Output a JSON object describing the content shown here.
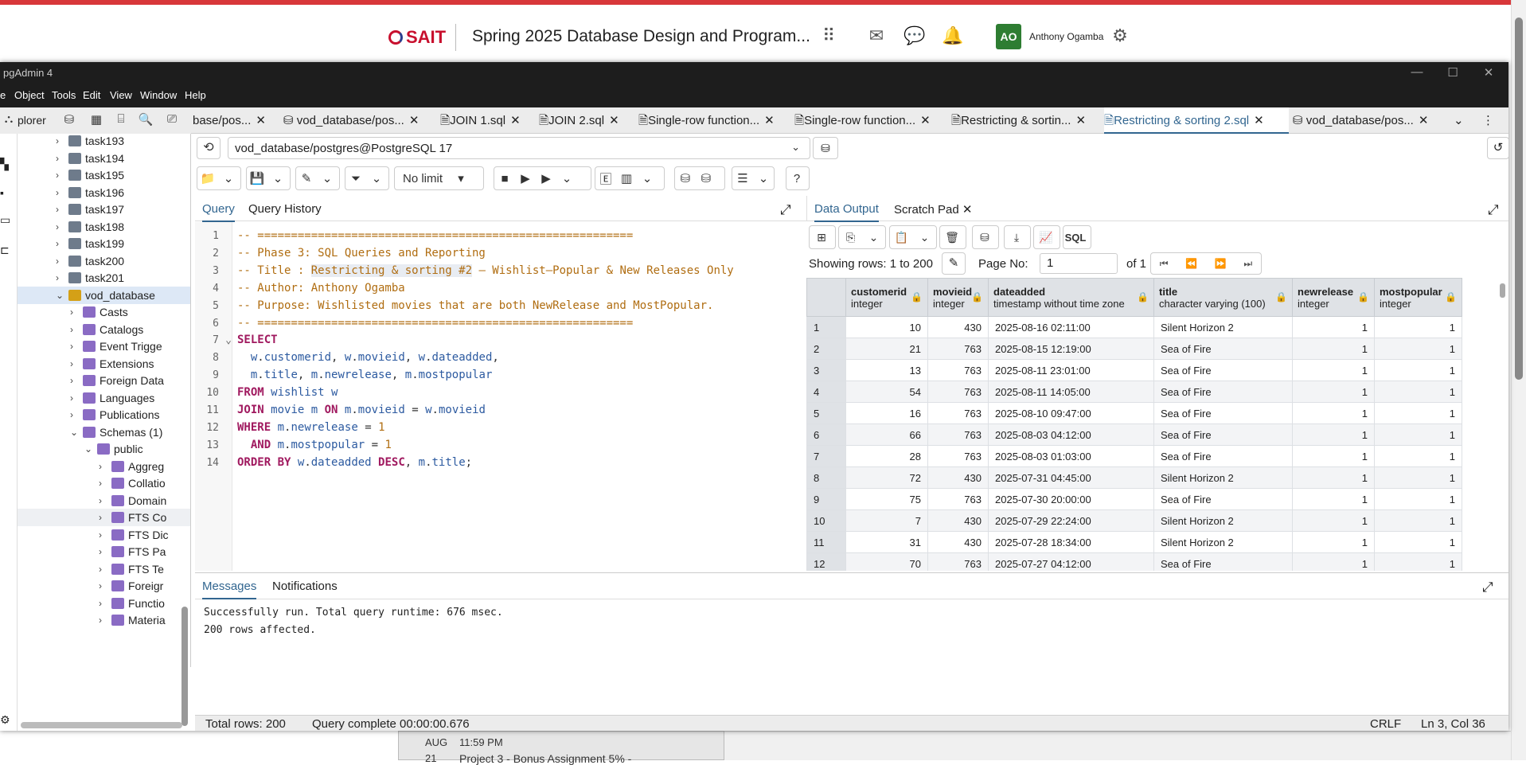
{
  "lms": {
    "logo": "SAIT",
    "course": "Spring 2025 Database Design and Program...",
    "avatar": "AO",
    "user": "Anthony Ogamba"
  },
  "behind": {
    "month": "AUG",
    "day": "21",
    "time": "11:59 PM",
    "item": "Project 3 - Bonus Assignment 5% -"
  },
  "window": {
    "title": "pgAdmin 4",
    "menu": [
      "e",
      "Object",
      "Tools",
      "Edit",
      "View",
      "Window",
      "Help"
    ]
  },
  "explorer": {
    "label": "plorer"
  },
  "tabs": [
    {
      "label": "base/pos...",
      "active": false
    },
    {
      "label": "vod_database/pos...",
      "active": false
    },
    {
      "label": "JOIN 1.sql",
      "active": false
    },
    {
      "label": "JOIN 2.sql",
      "active": false
    },
    {
      "label": "Single-row function...",
      "active": false
    },
    {
      "label": "Single-row function...",
      "active": false
    },
    {
      "label": "Restricting & sortin...",
      "active": false
    },
    {
      "label": "Restricting & sorting 2.sql",
      "active": true
    },
    {
      "label": "vod_database/pos...",
      "active": false
    }
  ],
  "tree": [
    {
      "label": "task193",
      "indent": 0,
      "icon": "table-icon"
    },
    {
      "label": "task194",
      "indent": 0,
      "icon": "table-icon"
    },
    {
      "label": "task195",
      "indent": 0,
      "icon": "table-icon"
    },
    {
      "label": "task196",
      "indent": 0,
      "icon": "table-icon"
    },
    {
      "label": "task197",
      "indent": 0,
      "icon": "table-icon"
    },
    {
      "label": "task198",
      "indent": 0,
      "icon": "table-icon"
    },
    {
      "label": "task199",
      "indent": 0,
      "icon": "table-icon"
    },
    {
      "label": "task200",
      "indent": 0,
      "icon": "table-icon"
    },
    {
      "label": "task201",
      "indent": 0,
      "icon": "table-icon"
    },
    {
      "label": "vod_database",
      "indent": 0,
      "icon": "database-icon",
      "open": true,
      "selected": true
    },
    {
      "label": "Casts",
      "indent": 1,
      "icon": "casts-icon"
    },
    {
      "label": "Catalogs",
      "indent": 1,
      "icon": "catalogs-icon"
    },
    {
      "label": "Event Trigge",
      "indent": 1,
      "icon": "event-trigger-icon"
    },
    {
      "label": "Extensions",
      "indent": 1,
      "icon": "extensions-icon"
    },
    {
      "label": "Foreign Data",
      "indent": 1,
      "icon": "foreign-data-icon"
    },
    {
      "label": "Languages",
      "indent": 1,
      "icon": "languages-icon"
    },
    {
      "label": "Publications",
      "indent": 1,
      "icon": "publications-icon"
    },
    {
      "label": "Schemas (1)",
      "indent": 1,
      "icon": "schemas-icon",
      "open": true
    },
    {
      "label": "public",
      "indent": 2,
      "icon": "schema-icon",
      "open": true
    },
    {
      "label": "Aggreg",
      "indent": 3,
      "icon": "aggregate-icon"
    },
    {
      "label": "Collatio",
      "indent": 3,
      "icon": "collation-icon"
    },
    {
      "label": "Domain",
      "indent": 3,
      "icon": "domain-icon"
    },
    {
      "label": "FTS Co",
      "indent": 3,
      "icon": "fts-config-icon",
      "hover": true
    },
    {
      "label": "FTS Dic",
      "indent": 3,
      "icon": "fts-dict-icon"
    },
    {
      "label": "FTS Pa",
      "indent": 3,
      "icon": "fts-parser-icon"
    },
    {
      "label": "FTS Te",
      "indent": 3,
      "icon": "fts-template-icon"
    },
    {
      "label": "Foreigr",
      "indent": 3,
      "icon": "foreign-table-icon"
    },
    {
      "label": "Functio",
      "indent": 3,
      "icon": "function-icon"
    },
    {
      "label": "Materia",
      "indent": 3,
      "icon": "mview-icon"
    }
  ],
  "connection": "vod_database/postgres@PostgreSQL 17",
  "toolbar": {
    "limit": "No limit"
  },
  "query_tabs": {
    "query": "Query",
    "history": "Query History"
  },
  "code_lines": [
    [
      [
        "cm",
        "-- ========================================================"
      ]
    ],
    [
      [
        "cm",
        "-- Phase 3: SQL Queries and Reporting"
      ]
    ],
    [
      [
        "cm",
        "-- Title : "
      ],
      [
        "cmhl",
        "Restricting & sorting #2"
      ],
      [
        "cm",
        " — Wishlist—Popular & New Releases Only"
      ]
    ],
    [
      [
        "cm",
        "-- Author: Anthony Ogamba"
      ]
    ],
    [
      [
        "cm",
        "-- Purpose: Wishlisted movies that are both NewRelease and MostPopular."
      ]
    ],
    [
      [
        "cm",
        "-- ========================================================"
      ]
    ],
    [
      [
        "kw",
        "SELECT"
      ]
    ],
    [
      [
        "op",
        "  "
      ],
      [
        "id",
        "w"
      ],
      [
        "op",
        "."
      ],
      [
        "id",
        "customerid"
      ],
      [
        "op",
        ", "
      ],
      [
        "id",
        "w"
      ],
      [
        "op",
        "."
      ],
      [
        "id",
        "movieid"
      ],
      [
        "op",
        ", "
      ],
      [
        "id",
        "w"
      ],
      [
        "op",
        "."
      ],
      [
        "id",
        "dateadded"
      ],
      [
        "op",
        ","
      ]
    ],
    [
      [
        "op",
        "  "
      ],
      [
        "id",
        "m"
      ],
      [
        "op",
        "."
      ],
      [
        "id",
        "title"
      ],
      [
        "op",
        ", "
      ],
      [
        "id",
        "m"
      ],
      [
        "op",
        "."
      ],
      [
        "id",
        "newrelease"
      ],
      [
        "op",
        ", "
      ],
      [
        "id",
        "m"
      ],
      [
        "op",
        "."
      ],
      [
        "id",
        "mostpopular"
      ]
    ],
    [
      [
        "kw",
        "FROM"
      ],
      [
        "op",
        " "
      ],
      [
        "id",
        "wishlist w"
      ]
    ],
    [
      [
        "kw",
        "JOIN"
      ],
      [
        "op",
        " "
      ],
      [
        "id",
        "movie m"
      ],
      [
        "op",
        " "
      ],
      [
        "kw",
        "ON"
      ],
      [
        "op",
        " "
      ],
      [
        "id",
        "m"
      ],
      [
        "op",
        "."
      ],
      [
        "id",
        "movieid"
      ],
      [
        "op",
        " = "
      ],
      [
        "id",
        "w"
      ],
      [
        "op",
        "."
      ],
      [
        "id",
        "movieid"
      ]
    ],
    [
      [
        "kw",
        "WHERE"
      ],
      [
        "op",
        " "
      ],
      [
        "id",
        "m"
      ],
      [
        "op",
        "."
      ],
      [
        "id",
        "newrelease"
      ],
      [
        "op",
        " = "
      ],
      [
        "nm",
        "1"
      ]
    ],
    [
      [
        "op",
        "  "
      ],
      [
        "kw",
        "AND"
      ],
      [
        "op",
        " "
      ],
      [
        "id",
        "m"
      ],
      [
        "op",
        "."
      ],
      [
        "id",
        "mostpopular"
      ],
      [
        "op",
        " = "
      ],
      [
        "nm",
        "1"
      ]
    ],
    [
      [
        "kw",
        "ORDER BY"
      ],
      [
        "op",
        " "
      ],
      [
        "id",
        "w"
      ],
      [
        "op",
        "."
      ],
      [
        "id",
        "dateadded"
      ],
      [
        "op",
        " "
      ],
      [
        "kw",
        "DESC"
      ],
      [
        "op",
        ", "
      ],
      [
        "id",
        "m"
      ],
      [
        "op",
        "."
      ],
      [
        "id",
        "title"
      ],
      [
        "op",
        ";"
      ]
    ]
  ],
  "data_tabs": {
    "output": "Data Output",
    "scratch": "Scratch Pad"
  },
  "sql_button": "SQL",
  "paging": {
    "showing": "Showing rows: 1 to 200",
    "page_label": "Page No:",
    "page": "1",
    "of": "of 1"
  },
  "columns": [
    {
      "name": "customerid",
      "type": "integer"
    },
    {
      "name": "movieid",
      "type": "integer"
    },
    {
      "name": "dateadded",
      "type": "timestamp without time zone"
    },
    {
      "name": "title",
      "type": "character varying (100)"
    },
    {
      "name": "newrelease",
      "type": "integer"
    },
    {
      "name": "mostpopular",
      "type": "integer"
    }
  ],
  "rows": [
    [
      "1",
      "10",
      "430",
      "2025-08-16 02:11:00",
      "Silent Horizon 2",
      "1",
      "1"
    ],
    [
      "2",
      "21",
      "763",
      "2025-08-15 12:19:00",
      "Sea of Fire",
      "1",
      "1"
    ],
    [
      "3",
      "13",
      "763",
      "2025-08-11 23:01:00",
      "Sea of Fire",
      "1",
      "1"
    ],
    [
      "4",
      "54",
      "763",
      "2025-08-11 14:05:00",
      "Sea of Fire",
      "1",
      "1"
    ],
    [
      "5",
      "16",
      "763",
      "2025-08-10 09:47:00",
      "Sea of Fire",
      "1",
      "1"
    ],
    [
      "6",
      "66",
      "763",
      "2025-08-03 04:12:00",
      "Sea of Fire",
      "1",
      "1"
    ],
    [
      "7",
      "28",
      "763",
      "2025-08-03 01:03:00",
      "Sea of Fire",
      "1",
      "1"
    ],
    [
      "8",
      "72",
      "430",
      "2025-07-31 04:45:00",
      "Silent Horizon 2",
      "1",
      "1"
    ],
    [
      "9",
      "75",
      "763",
      "2025-07-30 20:00:00",
      "Sea of Fire",
      "1",
      "1"
    ],
    [
      "10",
      "7",
      "430",
      "2025-07-29 22:24:00",
      "Silent Horizon 2",
      "1",
      "1"
    ],
    [
      "11",
      "31",
      "430",
      "2025-07-28 18:34:00",
      "Silent Horizon 2",
      "1",
      "1"
    ],
    [
      "12",
      "70",
      "763",
      "2025-07-27 04:12:00",
      "Sea of Fire",
      "1",
      "1"
    ]
  ],
  "messages_tabs": {
    "messages": "Messages",
    "notifications": "Notifications"
  },
  "messages": [
    "Successfully run. Total query runtime: 676 msec.",
    "200 rows affected."
  ],
  "status": {
    "total": "Total rows: 200",
    "complete": "Query complete 00:00:00.676",
    "eol": "CRLF",
    "pos": "Ln 3, Col 36"
  },
  "colors": {
    "accent": "#326690",
    "sait_red": "#c8102e",
    "avatar_green": "#2e7d32"
  }
}
